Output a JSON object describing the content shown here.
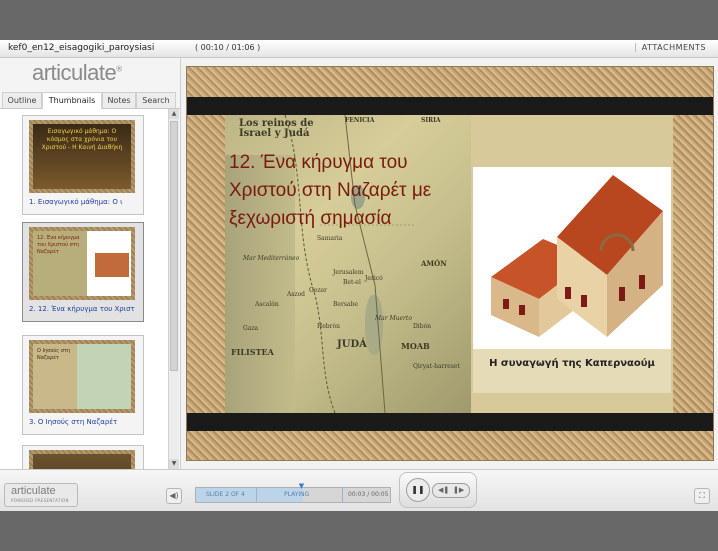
{
  "titlebar": {
    "title": "kef0_en12_eisagogiki_paroysiasi",
    "time": "( 00:10 / 01:06 )",
    "attachments": "ATTACHMENTS"
  },
  "sidebar": {
    "logo": "articulate",
    "tabs": [
      {
        "label": "Outline"
      },
      {
        "label": "Thumbnails"
      },
      {
        "label": "Notes"
      },
      {
        "label": "Search"
      }
    ],
    "thumbnails": [
      {
        "caption": "1. Εισαγωγικό μάθημα: Ο ι",
        "preview": "Εισαγωγικό μάθημα: Ο κόσμος στα χρόνια του Χριστού - Η Καινή Διαθήκη"
      },
      {
        "caption": "2. 12. Ένα κήρυγμα του Χριστ",
        "preview": "12. Ένα κήρυγμα του Χριστού στη Ναζαρέτ"
      },
      {
        "caption": "3. Ο Ιησούς στη Ναζαρέτ",
        "preview": "Ο Ιησούς στη Ναζαρέτ"
      },
      {
        "caption": "",
        "preview": ""
      }
    ],
    "selected_index": 1
  },
  "slide": {
    "title": "12. Ένα κήρυγμα του Χριστού στη Ναζαρέτ με ξεχωριστή σημασία",
    "photo_caption": "Η συναγωγή της Καπερναούμ",
    "map_labels": {
      "header": "Los reinos de Israel y Judá",
      "places": [
        "Samaria",
        "Jerusalem",
        "Bet-el",
        "Jericó",
        "Gezer",
        "Aszod",
        "Ascalón",
        "Gaza",
        "Hebrón",
        "Bersabe",
        "Dibón",
        "Qiryat-harreset",
        "Mar Muerto",
        "JUDÁ",
        "MOAB",
        "AMÓN",
        "SIRIA",
        "FENICIA",
        "FILISTEA",
        "Mar Mediterráneo"
      ]
    }
  },
  "bottombar": {
    "badge_name": "articulate",
    "badge_sub": "POWERED PRESENTATION",
    "slide_counter": "SLIDE 2 OF 4",
    "status": "PLAYING",
    "slide_time": "00:03 / 00:05",
    "progress_fraction": 0.55
  },
  "colors": {
    "title_red": "#7a1a0e",
    "link_blue": "#1f3fa3",
    "progress_fill": "#bcd4ea"
  }
}
